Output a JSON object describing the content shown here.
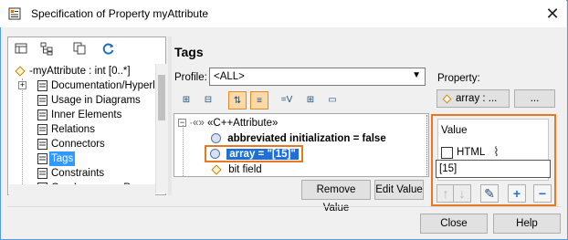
{
  "window": {
    "title": "Specification of Property myAttribute",
    "close_glyph": "✕"
  },
  "left_tree": {
    "toolbar_icons": [
      "list-view-icon",
      "tree-view-icon",
      "copy-icon",
      "refresh-icon"
    ],
    "root": "-myAttribute : int [0..*]",
    "items": [
      {
        "label": "Documentation/Hyperlin",
        "expander": "+"
      },
      {
        "label": "Usage in Diagrams",
        "expander": ""
      },
      {
        "label": "Inner Elements",
        "expander": ""
      },
      {
        "label": "Relations",
        "expander": ""
      },
      {
        "label": "Connectors",
        "expander": ""
      },
      {
        "label": "Tags",
        "expander": "",
        "selected": true
      },
      {
        "label": "Constraints",
        "expander": ""
      },
      {
        "label": "C++ Language Properti",
        "expander": ""
      }
    ]
  },
  "tags": {
    "heading": "Tags",
    "profile_label": "Profile:",
    "profile_value": "<ALL>",
    "property_label": "Property:",
    "property_value": "array : ...",
    "property_more": "...",
    "tree": {
      "stereotype": "«C++Attribute»",
      "rows": [
        {
          "text": "abbreviated initialization = false",
          "bold": true
        },
        {
          "text": "array = \"[15]\"",
          "selected": true
        },
        {
          "text": "bit field",
          "bold": false
        }
      ]
    },
    "remove_value": "Remove Value",
    "edit_value": "Edit Value"
  },
  "value_panel": {
    "label": "Value",
    "html_label": "HTML",
    "html_checked": false,
    "value": "[15]"
  },
  "footer": {
    "close": "Close",
    "help": "Help"
  },
  "colors": {
    "highlight": "#e87722",
    "selection": "#1e6fd6"
  }
}
